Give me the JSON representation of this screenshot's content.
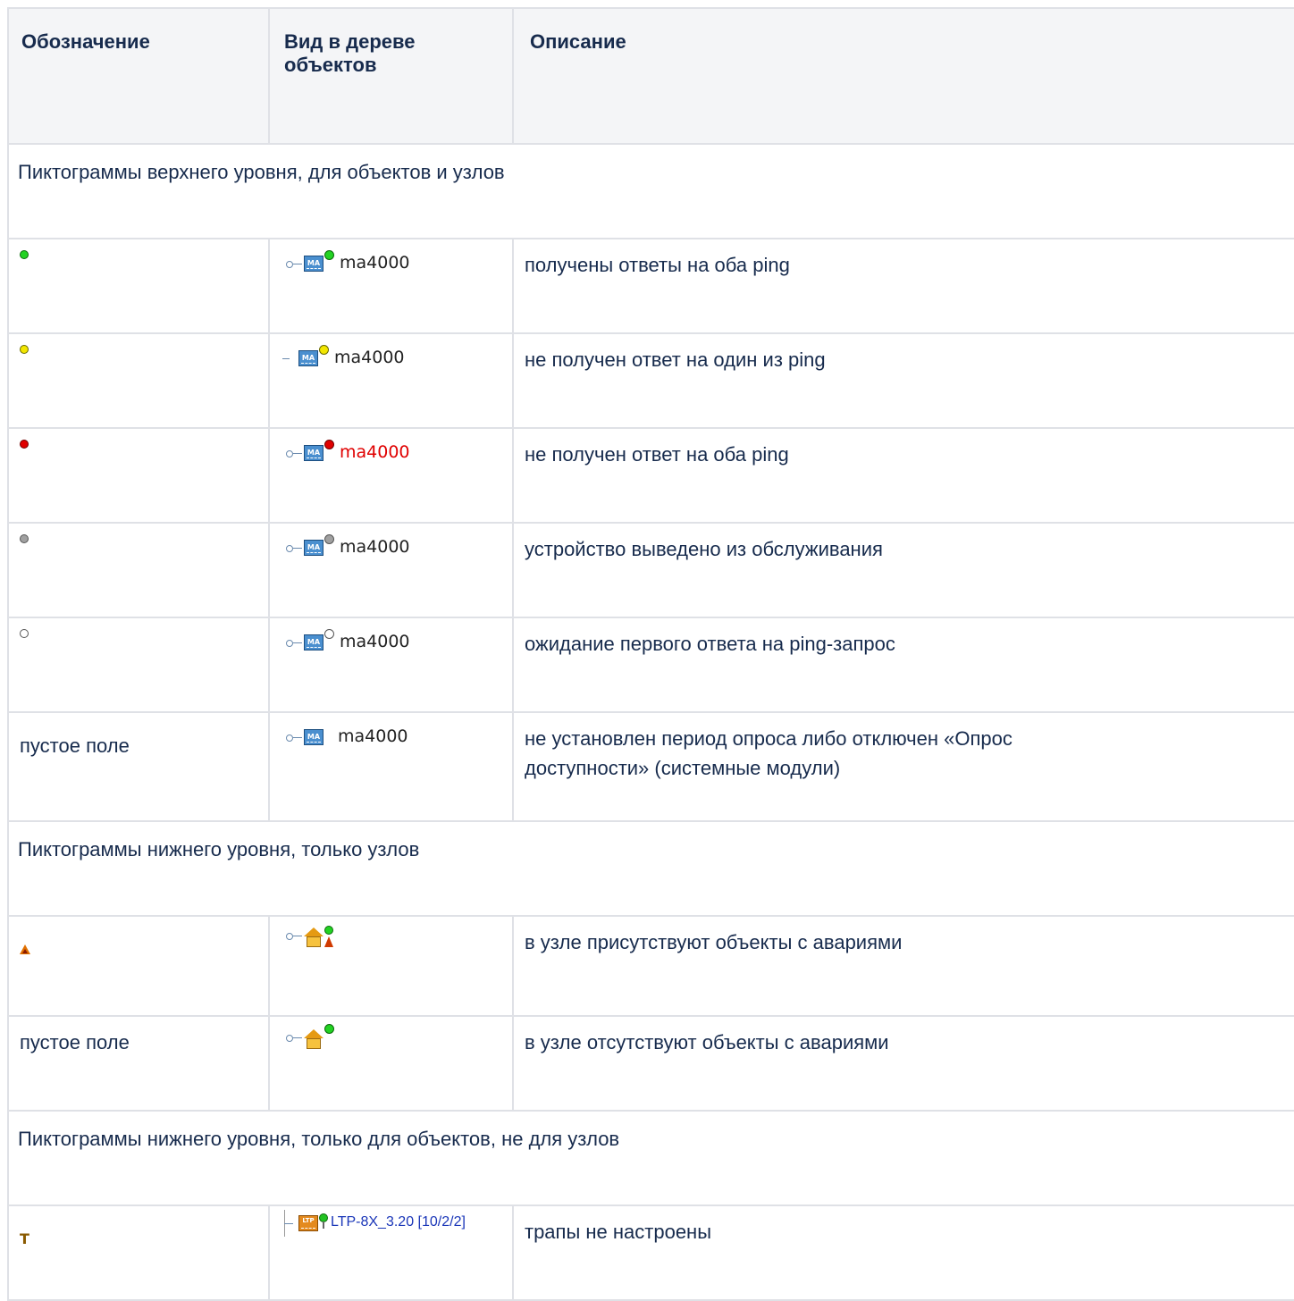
{
  "table": {
    "headers": [
      "Обозначение",
      "Вид в дереве объектов",
      "Описание"
    ],
    "header_col2_line1": "Вид в дереве",
    "header_col2_line2": "объектов",
    "sections": [
      "Пиктограммы верхнего уровня, для объектов и узлов",
      "Пиктограммы нижнего уровня, только узлов",
      "Пиктограммы нижнего уровня, только для объектов, не для узлов"
    ],
    "rows": [
      {
        "symbol": "green-dot-icon",
        "tree_label": "ma4000",
        "description": "получены ответы на оба ping"
      },
      {
        "symbol": "yellow-dot-icon",
        "tree_label": "ma4000",
        "description": "не получен ответ на один из ping"
      },
      {
        "symbol": "red-dot-icon",
        "tree_label": "ma4000",
        "description": "не получен ответ на оба ping"
      },
      {
        "symbol": "gray-dot-icon",
        "tree_label": "ma4000",
        "description": "устройство выведено из обслуживания"
      },
      {
        "symbol": "white-dot-icon",
        "tree_label": "ma4000",
        "description": "ожидание первого ответа на ping-запрос"
      },
      {
        "symbol_text": "пустое поле",
        "tree_label": "ma4000",
        "description": "не установлен период опроса либо отключен «Опрос доступности» (системные модули)"
      },
      {
        "symbol": "alarm-triangle-icon",
        "description": "в узле присутствуют объекты с авариями"
      },
      {
        "symbol_text": "пустое поле",
        "description": "в узле отсутствуют объекты с авариями"
      },
      {
        "symbol": "trap-t-icon",
        "tree_label": "LTP-8X_3.20 [10/2/2]",
        "description": "трапы не настроены"
      }
    ],
    "icon_text": {
      "ma": "MA",
      "ltp": "LTP"
    },
    "colors": {
      "border": "#dfe1e6",
      "header_bg": "#f4f5f7",
      "text": "#172b4d",
      "alarm_label": "#e00000",
      "ltp_label": "#1a36b8"
    }
  }
}
